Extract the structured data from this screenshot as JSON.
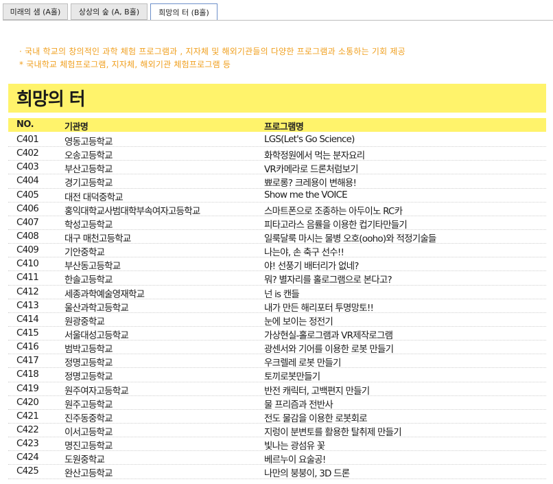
{
  "tabs": [
    {
      "label": "미래의 샘 (A홀)",
      "active": false
    },
    {
      "label": "상상의 숲 (A, B홀)",
      "active": false
    },
    {
      "label": "희망의 터 (B홀)",
      "active": true
    }
  ],
  "description": {
    "line1": "· 국내 학교의 창의적인 과학 체험 프로그램과 , 지자체 및 해외기관들의 다양한 프로그램과 소통하는 기회 제공",
    "line2": "* 국내학교 체험프로그램, 지자체, 해외기관 체험프로그램 등"
  },
  "section_title": "희망의 터",
  "table": {
    "headers": {
      "no": "NO.",
      "org": "기관명",
      "program": "프로그램명"
    },
    "rows": [
      {
        "no": "C401",
        "org": "영동고등학교",
        "program": "LGS(Let's Go Science)"
      },
      {
        "no": "C402",
        "org": "오송고등학교",
        "program": "화학정원에서 먹는 분자요리"
      },
      {
        "no": "C403",
        "org": "부산고등학교",
        "program": "VR카메라로 드론처럼보기"
      },
      {
        "no": "C404",
        "org": "경기고등학교",
        "program": "뾰로롱? 크레용이 변해용!"
      },
      {
        "no": "C405",
        "org": "대전 대덕중학교",
        "program": "Show me the VOICE"
      },
      {
        "no": "C406",
        "org": "홍익대학교사범대학부속여자고등학교",
        "program": "스마트폰으로 조종하는 아두이노 RC카"
      },
      {
        "no": "C407",
        "org": "학성고등학교",
        "program": "피타고라스 음률을 이용한 컵기타만들기"
      },
      {
        "no": "C408",
        "org": "대구 매천고등학교",
        "program": "일룩달룩 마시는 물병 오호(ooho)와 적정기술들"
      },
      {
        "no": "C409",
        "org": "기안중학교",
        "program": "나는야, 손 축구 선수!!"
      },
      {
        "no": "C410",
        "org": "부산동고등학교",
        "program": "야! 선풍기 배터리가 없네?"
      },
      {
        "no": "C411",
        "org": "한솔고등학교",
        "program": "뭐? 별자리를 홀로그램으로 본다고?"
      },
      {
        "no": "C412",
        "org": "세종과학예술영재학교",
        "program": "넌 is 캔들"
      },
      {
        "no": "C413",
        "org": "울산과학고등학교",
        "program": "내가 만든 해리포터 투명망토!!"
      },
      {
        "no": "C414",
        "org": "원광중학교",
        "program": "눈에 보이는 정전기"
      },
      {
        "no": "C415",
        "org": "서울대성고등학교",
        "program": "가상현실-홀로그램과 VR제작로그램"
      },
      {
        "no": "C416",
        "org": "범박고등학교",
        "program": "광센서와 기어를 이용한 로봇 만들기"
      },
      {
        "no": "C417",
        "org": "정명고등학교",
        "program": "우크렐레 로봇 만들기"
      },
      {
        "no": "C418",
        "org": "정명고등학교",
        "program": "토끼로봇만들기"
      },
      {
        "no": "C419",
        "org": "원주여자고등학교",
        "program": "반전 캐릭터, 고백편지 만들기"
      },
      {
        "no": "C420",
        "org": "원주고등학교",
        "program": "물 프리즘과 전반사"
      },
      {
        "no": "C421",
        "org": "진주동중학교",
        "program": "전도 물감을 이용한 로봇회로"
      },
      {
        "no": "C422",
        "org": "이서고등학교",
        "program": "지렁이 분변토를 활용한 탈취제 만들기"
      },
      {
        "no": "C423",
        "org": "명진고등학교",
        "program": "빛나는 광섬유 꽃"
      },
      {
        "no": "C424",
        "org": "도원중학교",
        "program": "베르누이 요술공!"
      },
      {
        "no": "C425",
        "org": "완산고등학교",
        "program": "나만의 붕붕이, 3D 드론"
      }
    ]
  }
}
